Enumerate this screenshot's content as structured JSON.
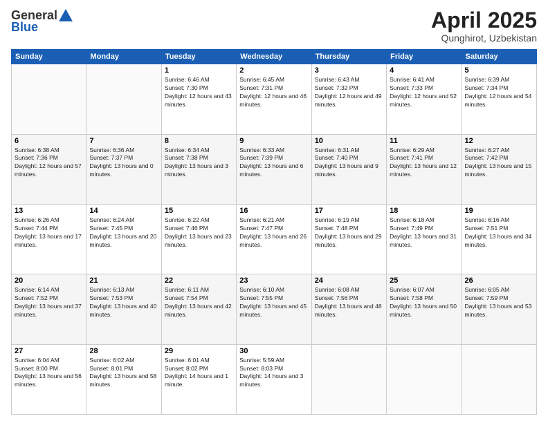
{
  "header": {
    "logo_line1": "General",
    "logo_line2": "Blue",
    "month_year": "April 2025",
    "location": "Qunghirot, Uzbekistan"
  },
  "days_of_week": [
    "Sunday",
    "Monday",
    "Tuesday",
    "Wednesday",
    "Thursday",
    "Friday",
    "Saturday"
  ],
  "weeks": [
    [
      {
        "day": "",
        "info": ""
      },
      {
        "day": "",
        "info": ""
      },
      {
        "day": "1",
        "info": "Sunrise: 6:46 AM\nSunset: 7:30 PM\nDaylight: 12 hours and 43 minutes."
      },
      {
        "day": "2",
        "info": "Sunrise: 6:45 AM\nSunset: 7:31 PM\nDaylight: 12 hours and 46 minutes."
      },
      {
        "day": "3",
        "info": "Sunrise: 6:43 AM\nSunset: 7:32 PM\nDaylight: 12 hours and 49 minutes."
      },
      {
        "day": "4",
        "info": "Sunrise: 6:41 AM\nSunset: 7:33 PM\nDaylight: 12 hours and 52 minutes."
      },
      {
        "day": "5",
        "info": "Sunrise: 6:39 AM\nSunset: 7:34 PM\nDaylight: 12 hours and 54 minutes."
      }
    ],
    [
      {
        "day": "6",
        "info": "Sunrise: 6:38 AM\nSunset: 7:36 PM\nDaylight: 12 hours and 57 minutes."
      },
      {
        "day": "7",
        "info": "Sunrise: 6:36 AM\nSunset: 7:37 PM\nDaylight: 13 hours and 0 minutes."
      },
      {
        "day": "8",
        "info": "Sunrise: 6:34 AM\nSunset: 7:38 PM\nDaylight: 13 hours and 3 minutes."
      },
      {
        "day": "9",
        "info": "Sunrise: 6:33 AM\nSunset: 7:39 PM\nDaylight: 13 hours and 6 minutes."
      },
      {
        "day": "10",
        "info": "Sunrise: 6:31 AM\nSunset: 7:40 PM\nDaylight: 13 hours and 9 minutes."
      },
      {
        "day": "11",
        "info": "Sunrise: 6:29 AM\nSunset: 7:41 PM\nDaylight: 13 hours and 12 minutes."
      },
      {
        "day": "12",
        "info": "Sunrise: 6:27 AM\nSunset: 7:42 PM\nDaylight: 13 hours and 15 minutes."
      }
    ],
    [
      {
        "day": "13",
        "info": "Sunrise: 6:26 AM\nSunset: 7:44 PM\nDaylight: 13 hours and 17 minutes."
      },
      {
        "day": "14",
        "info": "Sunrise: 6:24 AM\nSunset: 7:45 PM\nDaylight: 13 hours and 20 minutes."
      },
      {
        "day": "15",
        "info": "Sunrise: 6:22 AM\nSunset: 7:46 PM\nDaylight: 13 hours and 23 minutes."
      },
      {
        "day": "16",
        "info": "Sunrise: 6:21 AM\nSunset: 7:47 PM\nDaylight: 13 hours and 26 minutes."
      },
      {
        "day": "17",
        "info": "Sunrise: 6:19 AM\nSunset: 7:48 PM\nDaylight: 13 hours and 29 minutes."
      },
      {
        "day": "18",
        "info": "Sunrise: 6:18 AM\nSunset: 7:49 PM\nDaylight: 13 hours and 31 minutes."
      },
      {
        "day": "19",
        "info": "Sunrise: 6:16 AM\nSunset: 7:51 PM\nDaylight: 13 hours and 34 minutes."
      }
    ],
    [
      {
        "day": "20",
        "info": "Sunrise: 6:14 AM\nSunset: 7:52 PM\nDaylight: 13 hours and 37 minutes."
      },
      {
        "day": "21",
        "info": "Sunrise: 6:13 AM\nSunset: 7:53 PM\nDaylight: 13 hours and 40 minutes."
      },
      {
        "day": "22",
        "info": "Sunrise: 6:11 AM\nSunset: 7:54 PM\nDaylight: 13 hours and 42 minutes."
      },
      {
        "day": "23",
        "info": "Sunrise: 6:10 AM\nSunset: 7:55 PM\nDaylight: 13 hours and 45 minutes."
      },
      {
        "day": "24",
        "info": "Sunrise: 6:08 AM\nSunset: 7:56 PM\nDaylight: 13 hours and 48 minutes."
      },
      {
        "day": "25",
        "info": "Sunrise: 6:07 AM\nSunset: 7:58 PM\nDaylight: 13 hours and 50 minutes."
      },
      {
        "day": "26",
        "info": "Sunrise: 6:05 AM\nSunset: 7:59 PM\nDaylight: 13 hours and 53 minutes."
      }
    ],
    [
      {
        "day": "27",
        "info": "Sunrise: 6:04 AM\nSunset: 8:00 PM\nDaylight: 13 hours and 56 minutes."
      },
      {
        "day": "28",
        "info": "Sunrise: 6:02 AM\nSunset: 8:01 PM\nDaylight: 13 hours and 58 minutes."
      },
      {
        "day": "29",
        "info": "Sunrise: 6:01 AM\nSunset: 8:02 PM\nDaylight: 14 hours and 1 minute."
      },
      {
        "day": "30",
        "info": "Sunrise: 5:59 AM\nSunset: 8:03 PM\nDaylight: 14 hours and 3 minutes."
      },
      {
        "day": "",
        "info": ""
      },
      {
        "day": "",
        "info": ""
      },
      {
        "day": "",
        "info": ""
      }
    ]
  ]
}
